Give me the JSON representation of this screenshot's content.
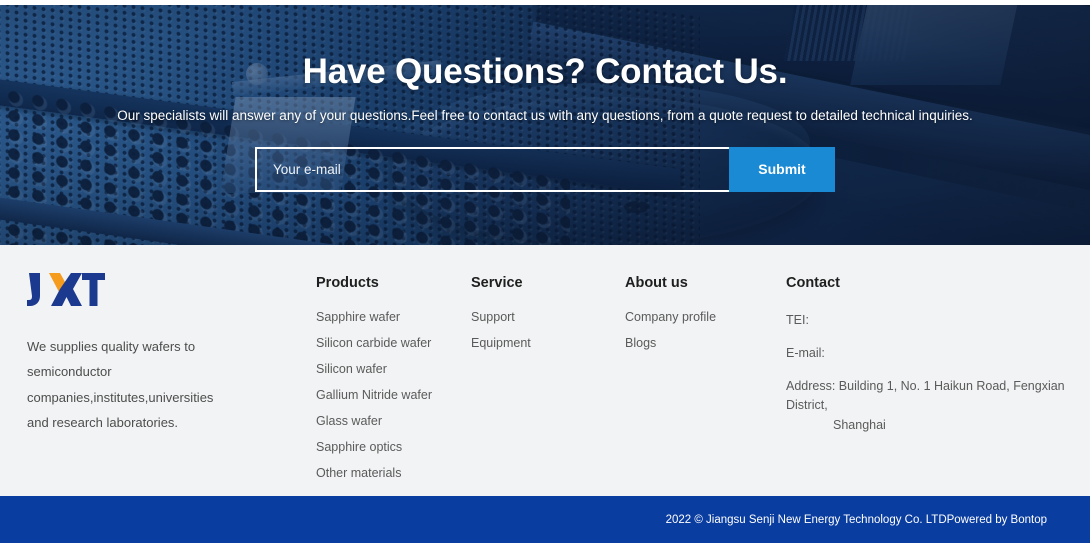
{
  "hero": {
    "title": "Have Questions? Contact Us.",
    "subtitle": "Our specialists will answer any of your questions.Feel free to contact us with any questions, from a quote request to detailed technical inquiries.",
    "email_placeholder": "Your e-mail",
    "email_value": "",
    "submit_label": "Submit",
    "submit_color": "#1a8ad4",
    "background_image": "industrial-wafer-machine-photo-blue-tint"
  },
  "footer": {
    "background_color": "#f2f3f4",
    "brand": {
      "logo_text": "JXT",
      "logo_colors": {
        "primary": "#1b3a8f",
        "accent": "#f59b1e"
      },
      "description": "We supplies quality wafers to semiconductor companies,institutes,universities and research laboratories."
    },
    "columns": [
      {
        "title": "Products",
        "links": [
          "Sapphire wafer",
          "Silicon carbide wafer",
          "Silicon wafer",
          "Gallium Nitride wafer",
          "Glass wafer",
          "Sapphire optics",
          "Other materials"
        ]
      },
      {
        "title": "Service",
        "links": [
          "Support",
          "Equipment"
        ]
      },
      {
        "title": "About us",
        "links": [
          "Company profile",
          "Blogs"
        ]
      }
    ],
    "contact": {
      "title": "Contact",
      "tel_label": "TEI:",
      "email_label": "E-mail:",
      "address_line1": "Address: Building 1, No. 1 Haikun Road, Fengxian District,",
      "address_line2": "Shanghai"
    }
  },
  "bottom_bar": {
    "background_color": "#0A3DA0",
    "copyright": "2022 © Jiangsu Senji New Energy Technology Co. LTDPowered by Bontop"
  }
}
